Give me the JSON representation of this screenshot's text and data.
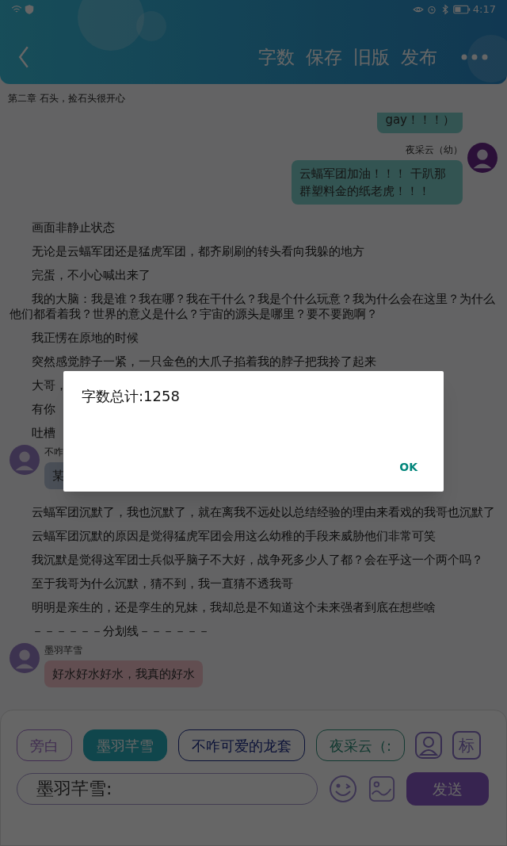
{
  "status_bar": {
    "time": "4:17"
  },
  "header": {
    "actions": [
      "字数",
      "保存",
      "旧版",
      "发布"
    ]
  },
  "chapter_title": "第二章 石头，捡石头很开心",
  "story": [
    {
      "kind": "bubble_right",
      "text": "gay！！！）"
    },
    {
      "kind": "bubble_right",
      "name": "夜采云（幼）",
      "text": "云蝠军团加油！！！ 干趴那群塑料金的纸老虎！！！"
    },
    {
      "kind": "paragraph",
      "text": "画面非静止状态"
    },
    {
      "kind": "paragraph",
      "text": "无论是云蝠军团还是猛虎军团，都齐刷刷的转头看向我躲的地方"
    },
    {
      "kind": "paragraph",
      "text": "完蛋，不小心喊出来了"
    },
    {
      "kind": "paragraph",
      "text": "我的大脑：我是谁？我在哪？我在干什么？我是个什么玩意？我为什么会在这里？为什么他们都看着我？世界的意义是什么？宇宙的源头是哪里？要不要跑啊？"
    },
    {
      "kind": "paragraph",
      "text": "我正愣在原地的时候"
    },
    {
      "kind": "paragraph",
      "text": "突然感觉脖子一紧，一只金色的大爪子掐着我的脖子把我拎了起来"
    },
    {
      "kind": "paragraph",
      "text": "大哥，"
    },
    {
      "kind": "paragraph",
      "text": "有你"
    },
    {
      "kind": "paragraph",
      "text": "吐槽"
    },
    {
      "kind": "bubble_left",
      "name": "不咋",
      "text": "某"
    },
    {
      "kind": "paragraph",
      "text": "云蝠军团沉默了，我也沉默了，就在离我不远处以总结经验的理由来看戏的我哥也沉默了"
    },
    {
      "kind": "paragraph",
      "text": "云蝠军团沉默的原因是觉得猛虎军团会用这么幼稚的手段来威胁他们非常可笑"
    },
    {
      "kind": "paragraph",
      "text": "我沉默是觉得这军团士兵似乎脑子不大好，战争死多少人了都？会在乎这一个两个吗？"
    },
    {
      "kind": "paragraph",
      "text": "至于我哥为什么沉默，猜不到，我一直猜不透我哥"
    },
    {
      "kind": "paragraph",
      "text": "明明是亲生的，还是孪生的兄妹，我却总是不知道这个未来强者到底在想些啥"
    },
    {
      "kind": "paragraph",
      "text": "－－－－－－分划线－－－－－－"
    },
    {
      "kind": "bubble_left",
      "name": "墨羽芊雪",
      "text": "好水好水好水，我真的好水"
    }
  ],
  "characters": [
    {
      "label": "旁白",
      "selected": false
    },
    {
      "label": "墨羽芊雪",
      "selected": true
    },
    {
      "label": "不咋可爱的龙套",
      "selected": false
    },
    {
      "label": "夜采云（:",
      "selected": false
    }
  ],
  "mark_button": "标",
  "composer": {
    "value": "墨羽芊雪:",
    "send": "发送"
  },
  "dialog": {
    "message": "字数总计:1258",
    "button": "OK"
  }
}
